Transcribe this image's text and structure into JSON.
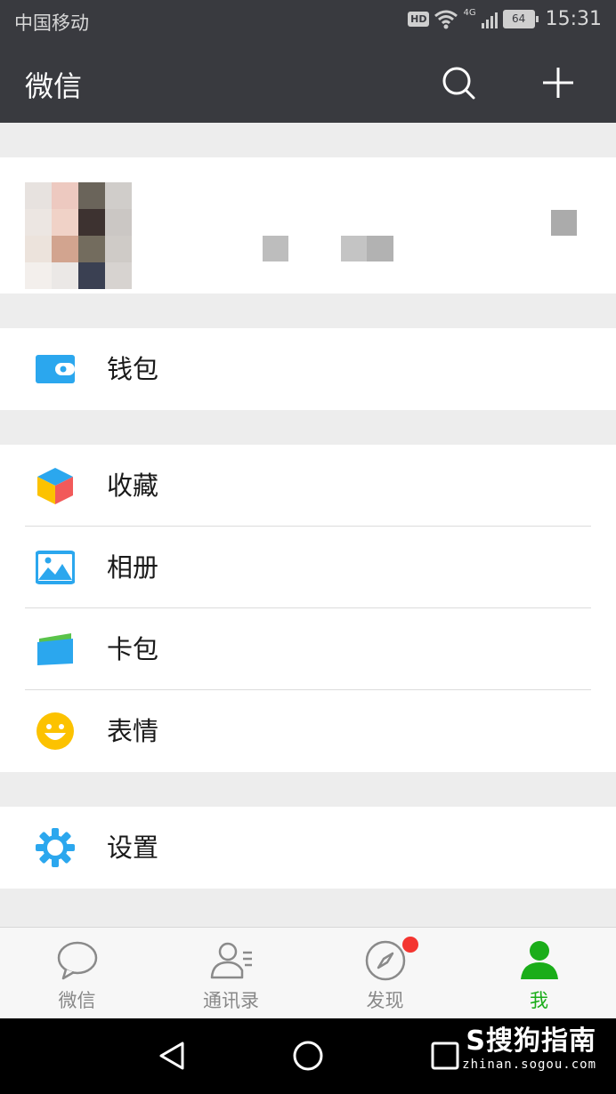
{
  "status_bar": {
    "carrier": "中国移动",
    "network": "4G",
    "battery": "64",
    "time": "15:31"
  },
  "header": {
    "title": "微信"
  },
  "sections": [
    {
      "items": [
        {
          "label": "钱包",
          "icon": "wallet-icon"
        }
      ]
    },
    {
      "items": [
        {
          "label": "收藏",
          "icon": "favorites-cube-icon"
        },
        {
          "label": "相册",
          "icon": "album-picture-icon"
        },
        {
          "label": "卡包",
          "icon": "card-pack-icon"
        },
        {
          "label": "表情",
          "icon": "smiley-icon"
        }
      ]
    },
    {
      "items": [
        {
          "label": "设置",
          "icon": "settings-gear-icon"
        }
      ]
    }
  ],
  "tabs": [
    {
      "label": "微信",
      "icon": "chat-bubble-icon",
      "active": false
    },
    {
      "label": "通讯录",
      "icon": "contacts-icon",
      "active": false
    },
    {
      "label": "发现",
      "icon": "compass-icon",
      "active": false,
      "badge": true
    },
    {
      "label": "我",
      "icon": "me-person-icon",
      "active": true
    }
  ],
  "colors": {
    "header_bg": "#393a3f",
    "active_green": "#1aad19",
    "icon_blue": "#2ba7ee",
    "badge_red": "#f43530"
  },
  "watermark": {
    "logo": "S搜狗指南",
    "url": "zhinan.sogou.com"
  }
}
